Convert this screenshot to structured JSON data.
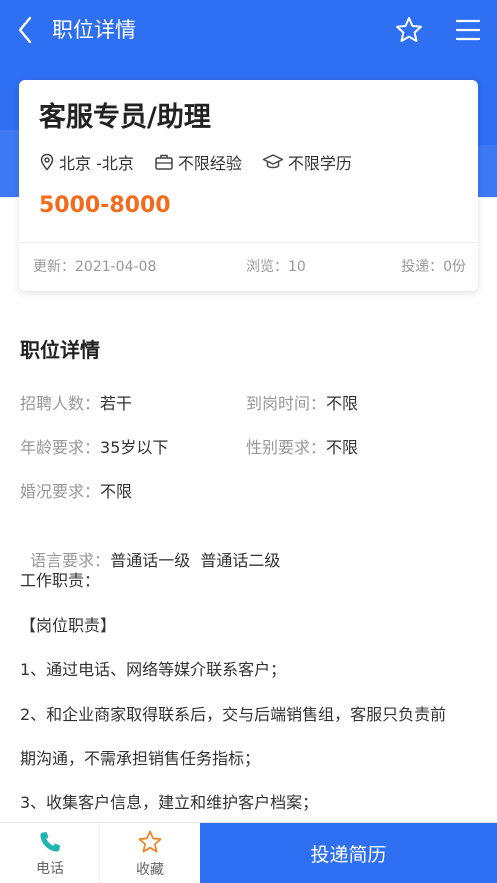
{
  "header": {
    "title": "职位详情"
  },
  "job": {
    "title": "客服专员/助理",
    "location": "北京 -北京",
    "experience": "不限经验",
    "education": "不限学历",
    "salary": "5000-8000",
    "updated": "更新：2021-04-08",
    "views": "浏览：10",
    "applications": "投递：0份"
  },
  "details": {
    "title": "职位详情",
    "fields": [
      {
        "label": "招聘人数：",
        "value": "若干"
      },
      {
        "label": "到岗时间：",
        "value": "不限"
      },
      {
        "label": "年龄要求：",
        "value": "35岁以下"
      },
      {
        "label": "性别要求：",
        "value": "不限"
      },
      {
        "label": "婚况要求：",
        "value": "不限"
      },
      {
        "label": "语言要求：",
        "value": "普通话一级  普通话二级"
      }
    ],
    "body": [
      "工作职责：",
      "【岗位职责】",
      "1、通过电话、网络等媒介联系客户；",
      "2、和企业商家取得联系后，交与后端销售组，客服只负责前",
      "期沟通，不需承担销售任务指标；",
      "3、收集客户信息，建立和维护客户档案；"
    ]
  },
  "bottom": {
    "phone_label": "电话",
    "favorite_label": "收藏",
    "apply_label": "投递简历"
  },
  "colors": {
    "primary": "#2f6ff2",
    "salary": "#f26b1d",
    "phone_icon": "#22b5b0",
    "favorite_icon": "#f0862a"
  }
}
